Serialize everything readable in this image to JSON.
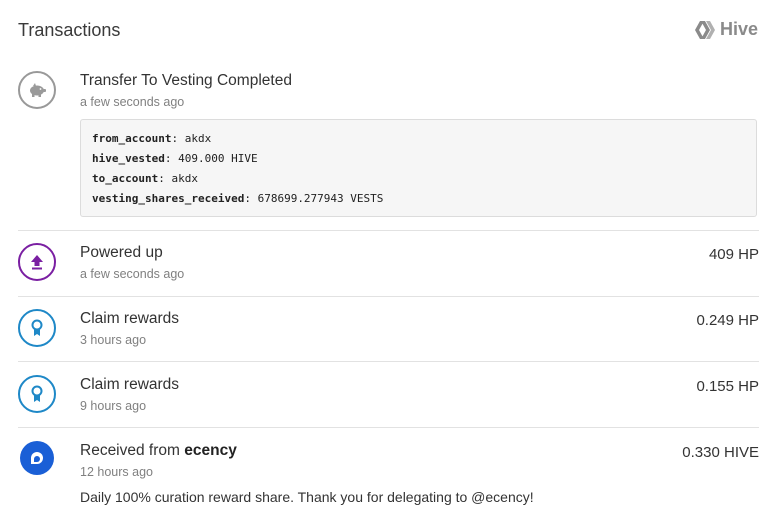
{
  "header": {
    "title": "Transactions",
    "chain_label": "Hive"
  },
  "transactions": [
    {
      "icon": "piggy-bank-icon",
      "name": "Transfer To Vesting Completed",
      "time": "a few seconds ago",
      "details": [
        {
          "key": "from_account",
          "value": "akdx"
        },
        {
          "key": "hive_vested",
          "value": "409.000 HIVE"
        },
        {
          "key": "to_account",
          "value": "akdx"
        },
        {
          "key": "vesting_shares_received",
          "value": "678699.277943 VESTS"
        }
      ]
    },
    {
      "icon": "power-up-arrow-icon",
      "name": "Powered up",
      "time": "a few seconds ago",
      "amount": "409 HP"
    },
    {
      "icon": "reward-ribbon-icon",
      "name": "Claim rewards",
      "time": "3 hours ago",
      "amount": "0.249 HP"
    },
    {
      "icon": "reward-ribbon-icon",
      "name": "Claim rewards",
      "time": "9 hours ago",
      "amount": "0.155 HP"
    },
    {
      "icon": "ecency-logo-icon",
      "name_prefix": "Received from",
      "from": "ecency",
      "time": "12 hours ago",
      "amount": "0.330 HIVE",
      "memo": "Daily 100% curation reward share. Thank you for delegating to @ecency!"
    }
  ],
  "colors": {
    "powerup": "#7a1fa2",
    "claim": "#1e88c7",
    "ecency": "#1a5fd6",
    "received_amount": "#3aa34a",
    "neutral_icon": "#999999"
  }
}
